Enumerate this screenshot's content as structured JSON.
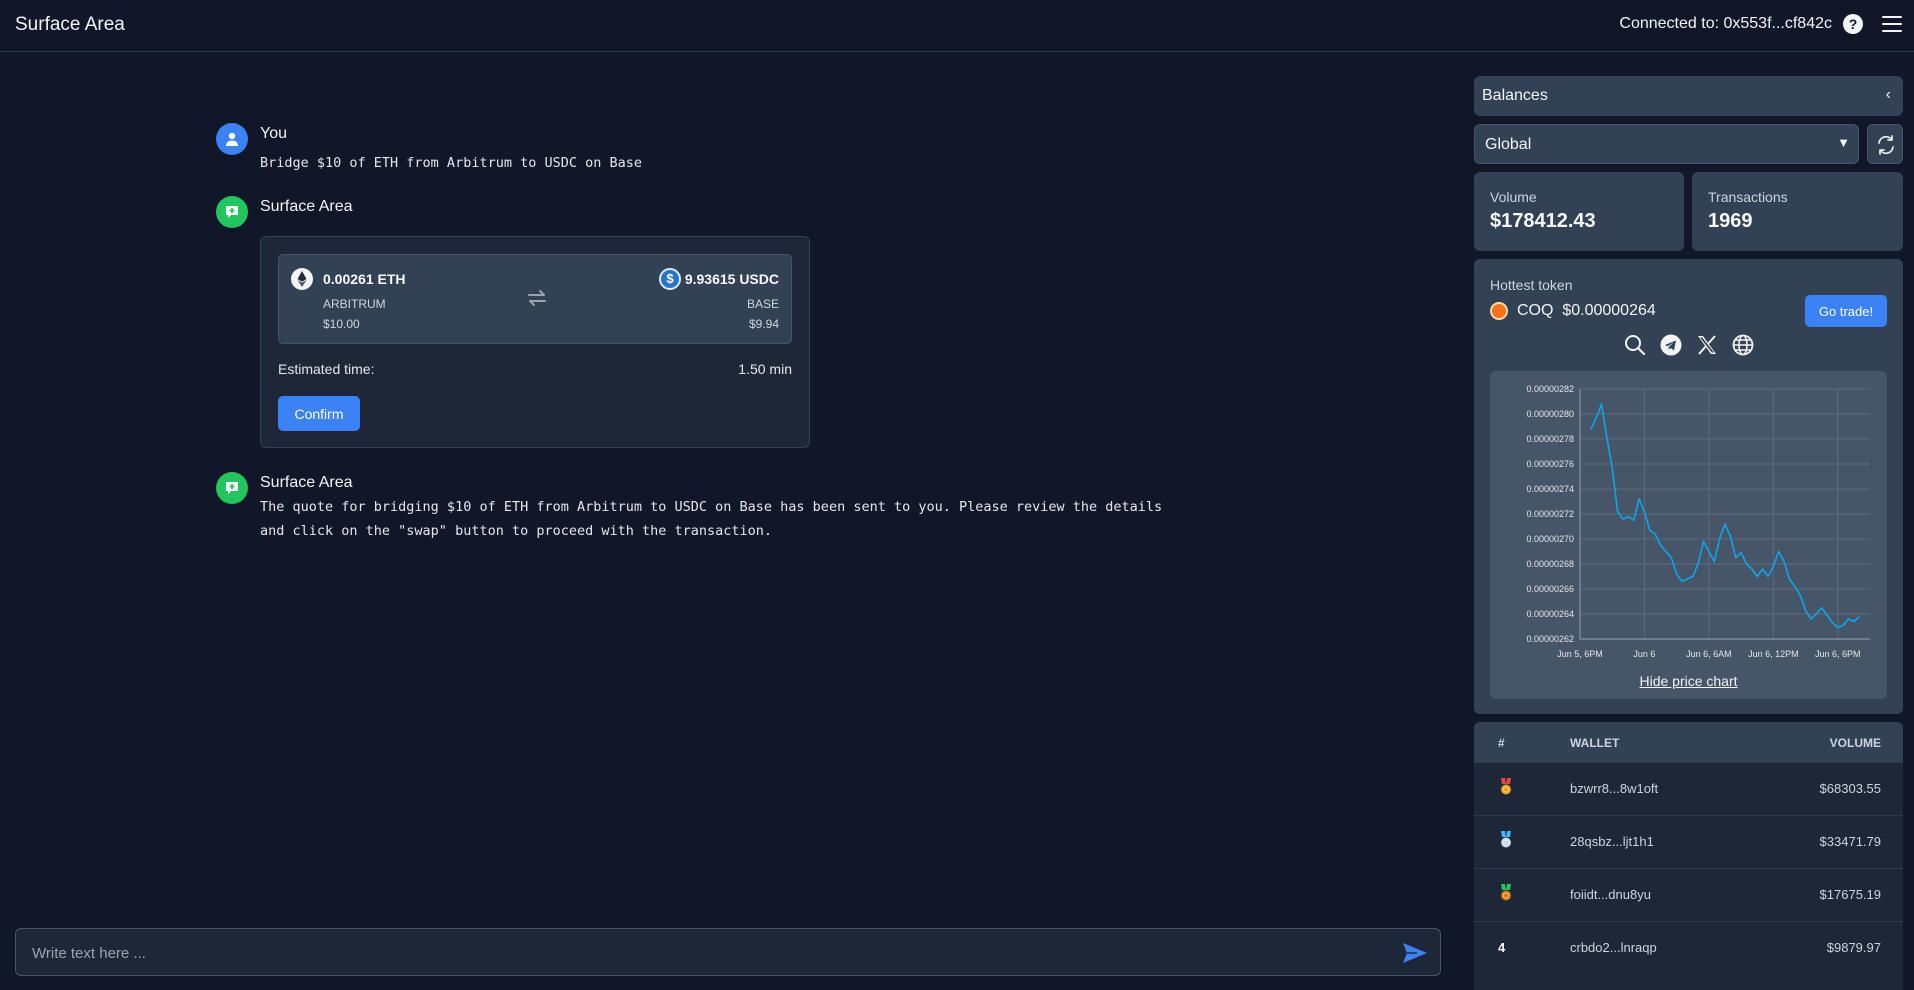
{
  "header": {
    "title": "Surface Area",
    "connected": "Connected to: 0x553f...cf842c"
  },
  "chat": {
    "messages": [
      {
        "author": "You",
        "text": "Bridge $10 of ETH from Arbitrum to USDC on Base"
      },
      {
        "author": "Surface Area",
        "text": ""
      },
      {
        "author": "Surface Area",
        "lines": [
          "The quote for bridging $10 of ETH from Arbitrum to USDC on Base has been sent to you. Please review the details",
          "and click on the \"swap\" button to proceed with the transaction."
        ]
      }
    ],
    "quote": {
      "from_amount": "0.00261 ETH",
      "from_chain": "ARBITRUM",
      "from_usd": "$10.00",
      "to_amount": "9.93615 USDC",
      "to_chain": "BASE",
      "to_usd": "$9.94",
      "est_label": "Estimated time:",
      "est_value": "1.50 min",
      "confirm_label": "Confirm"
    },
    "composer_placeholder": "Write text here ..."
  },
  "sidebar": {
    "title": "Balances",
    "scope": "Global",
    "volume_label": "Volume",
    "volume_value": "$178412.43",
    "tx_label": "Transactions",
    "tx_value": "1969",
    "hottest_label": "Hottest token",
    "token_name": "COQ",
    "token_price": "$0.00000264",
    "trade_label": "Go trade!",
    "hide_chart_label": "Hide price chart",
    "leaderboard": {
      "headers": [
        "#",
        "WALLET",
        "VOLUME"
      ],
      "rows": [
        {
          "rank": "1",
          "medal": "gold",
          "wallet": "bzwrr8...8w1oft",
          "volume": "$68303.55"
        },
        {
          "rank": "2",
          "medal": "silver",
          "wallet": "28qsbz...ljt1h1",
          "volume": "$33471.79"
        },
        {
          "rank": "3",
          "medal": "bronze",
          "wallet": "foiidt...dnu8yu",
          "volume": "$17675.19"
        },
        {
          "rank": "4",
          "medal": "",
          "wallet": "crbdo2...lnraqp",
          "volume": "$9879.97"
        }
      ]
    }
  },
  "colors": {
    "accent": "#3b82f6",
    "bot": "#22c55e",
    "line": "#0ea5e9"
  },
  "chart_data": {
    "type": "line",
    "title": "",
    "xlabel": "",
    "ylabel": "",
    "x_ticks": [
      "Jun 5, 6PM",
      "Jun 6",
      "Jun 6, 6AM",
      "Jun 6, 12PM",
      "Jun 6, 6PM"
    ],
    "y_ticks": [
      "0.00000282",
      "0.00000280",
      "0.00000278",
      "0.00000276",
      "0.00000274",
      "0.00000272",
      "0.00000270",
      "0.00000268",
      "0.00000266",
      "0.00000264",
      "0.00000262"
    ],
    "ylim": [
      2.62e-06,
      2.82e-06
    ],
    "xlim_hours": [
      0,
      27
    ],
    "series": [
      {
        "points_hours": [
          1,
          1.3,
          1.7,
          2,
          2.5,
          3,
          3.5,
          4,
          4.5,
          5,
          5.5,
          6,
          6.5,
          7,
          7.5,
          8,
          8.5,
          9,
          9.5,
          10,
          10.5,
          11,
          11.5,
          12,
          12.5,
          13,
          13.5,
          14,
          14.5,
          15,
          15.5,
          16,
          16.5,
          17,
          17.5,
          18,
          18.5,
          19,
          19.5,
          20,
          20.5,
          21,
          21.5,
          22,
          22.5,
          23,
          23.5,
          24,
          24.5,
          25,
          25.5,
          26
        ],
        "values": [
          2.788e-06,
          2.793e-06,
          2.801e-06,
          2.808e-06,
          2.781e-06,
          2.757e-06,
          2.722e-06,
          2.716e-06,
          2.718e-06,
          2.715e-06,
          2.732e-06,
          2.722e-06,
          2.707e-06,
          2.704e-06,
          2.695e-06,
          2.69e-06,
          2.685e-06,
          2.672e-06,
          2.666e-06,
          2.668e-06,
          2.67e-06,
          2.68e-06,
          2.698e-06,
          2.69e-06,
          2.682e-06,
          2.7e-06,
          2.712e-06,
          2.702e-06,
          2.685e-06,
          2.689e-06,
          2.68e-06,
          2.676e-06,
          2.67e-06,
          2.676e-06,
          2.67e-06,
          2.678e-06,
          2.69e-06,
          2.682e-06,
          2.668e-06,
          2.662e-06,
          2.655e-06,
          2.643e-06,
          2.636e-06,
          2.64e-06,
          2.645e-06,
          2.639e-06,
          2.633e-06,
          2.629e-06,
          2.631e-06,
          2.636e-06,
          2.634e-06,
          2.638e-06
        ]
      }
    ]
  }
}
